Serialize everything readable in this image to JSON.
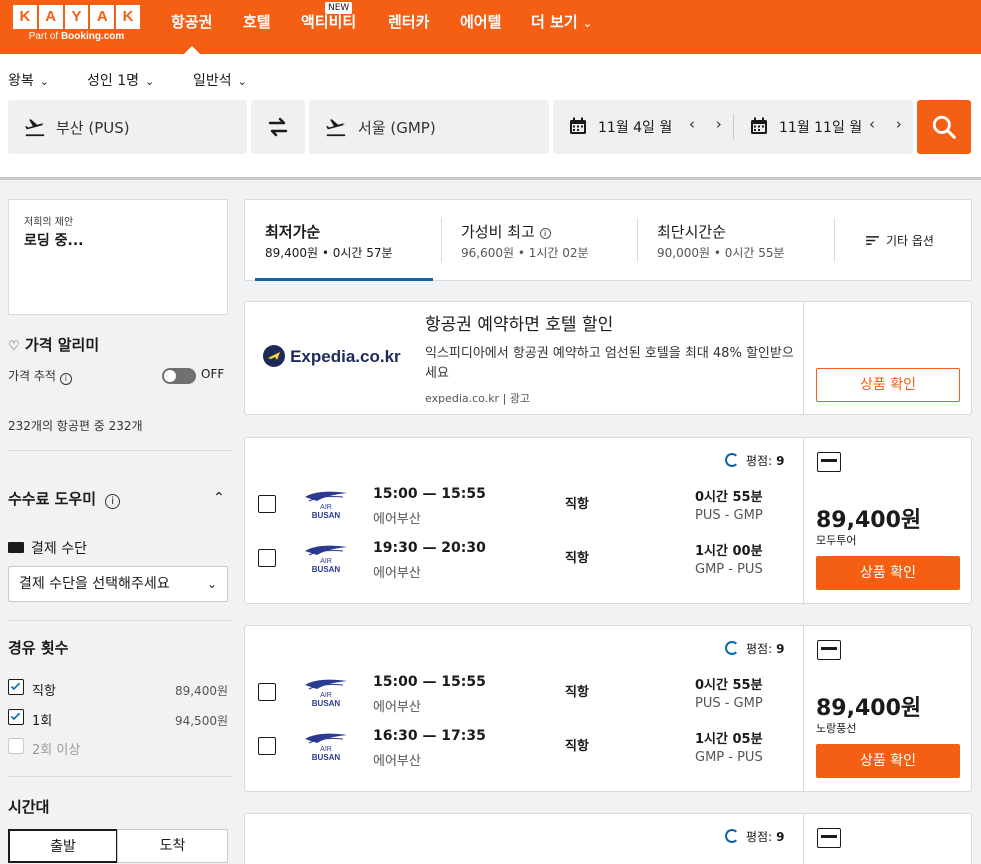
{
  "nav": {
    "logo_letters": [
      "K",
      "A",
      "Y",
      "A",
      "K"
    ],
    "logo_sub_prefix": "Part of",
    "logo_sub_brand": "Booking.com",
    "items": [
      {
        "label": "항공권"
      },
      {
        "label": "호텔"
      },
      {
        "label": "액티비티",
        "badge": "NEW"
      },
      {
        "label": "렌터카"
      },
      {
        "label": "에어텔"
      },
      {
        "label": "더 보기"
      }
    ]
  },
  "search": {
    "trip_type": "왕복",
    "travelers": "성인 1명",
    "cabin": "일반석",
    "origin": "부산 (PUS)",
    "destination": "서울 (GMP)",
    "depart_date": "11월 4일 월",
    "return_date": "11월 11일 월",
    "date_arrows": "‹ ›"
  },
  "sidebar": {
    "offer_label": "저희의 제안",
    "offer_status": "로딩 중...",
    "price_alert_title": "가격 알리미",
    "price_track_label": "가격 추적",
    "toggle_state": "OFF",
    "count_text": "232개의 항공편 중 232개",
    "fee_title": "수수료 도우미",
    "payment_label": "결제 수단",
    "payment_placeholder": "결제 수단을 선택해주세요",
    "stops_title": "경유 횟수",
    "stops": [
      {
        "label": "직항",
        "price": "89,400원",
        "checked": true,
        "disabled": false
      },
      {
        "label": "1회",
        "price": "94,500원",
        "checked": true,
        "disabled": false
      },
      {
        "label": "2회 이상",
        "price": "",
        "checked": false,
        "disabled": true
      }
    ],
    "time_title": "시간대",
    "time_tabs": [
      "출발",
      "도착"
    ]
  },
  "sort": {
    "tabs": [
      {
        "name": "최저가순",
        "sub": "89,400원 • 0시간 57분"
      },
      {
        "name": "가성비 최고",
        "sub": "96,600원 • 1시간 02분"
      },
      {
        "name": "최단시간순",
        "sub": "90,000원 • 0시간 55분"
      }
    ],
    "more_label": "기타 옵션"
  },
  "ad": {
    "brand": "Expedia.co.kr",
    "title": "항공권 예약하면 호텔 할인",
    "desc": "익스피디아에서 항공권 예약하고 엄선된 호텔을 최대 48% 할인받으세요",
    "source": "expedia.co.kr | 광고",
    "button": "상품 확인"
  },
  "results": [
    {
      "rating_label": "평점:",
      "rating": "9",
      "legs": [
        {
          "times": "15:00 — 15:55",
          "carrier": "에어부산",
          "stops": "직항",
          "duration": "0시간 55분",
          "route": "PUS - GMP"
        },
        {
          "times": "19:30 — 20:30",
          "carrier": "에어부산",
          "stops": "직항",
          "duration": "1시간 00분",
          "route": "GMP - PUS"
        }
      ],
      "price": "89,400원",
      "provider": "모두투어",
      "button": "상품 확인"
    },
    {
      "rating_label": "평점:",
      "rating": "9",
      "legs": [
        {
          "times": "15:00 — 15:55",
          "carrier": "에어부산",
          "stops": "직항",
          "duration": "0시간 55분",
          "route": "PUS - GMP"
        },
        {
          "times": "16:30 — 17:35",
          "carrier": "에어부산",
          "stops": "직항",
          "duration": "1시간 05분",
          "route": "GMP - PUS"
        }
      ],
      "price": "89,400원",
      "provider": "노랑풍선",
      "button": "상품 확인"
    },
    {
      "rating_label": "평점:",
      "rating": "9"
    }
  ],
  "airline_logo": {
    "line1": "AIR",
    "line2": "BUSAN"
  },
  "colors": {
    "brand": "#f45f13",
    "accent": "#0b6aa6"
  }
}
